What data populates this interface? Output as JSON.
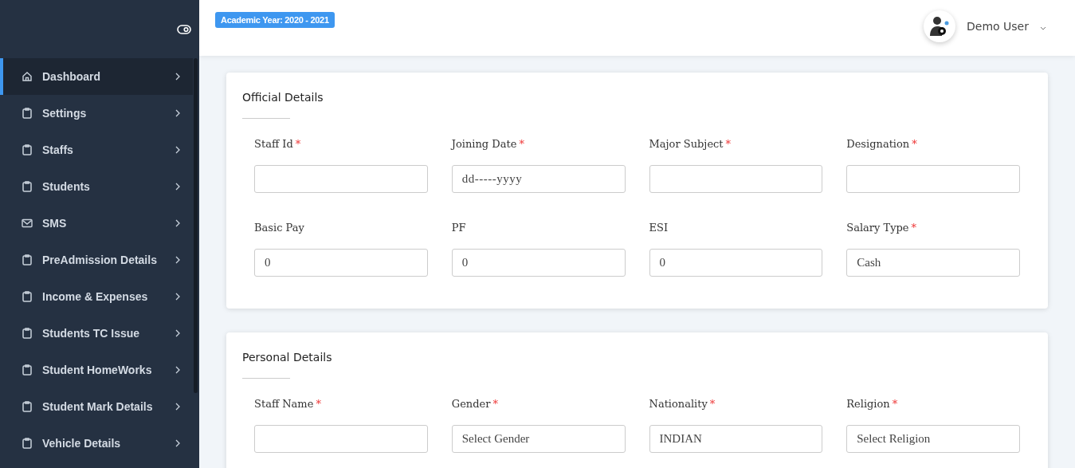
{
  "header": {
    "academic_year": "Academic Year: 2020 - 2021",
    "user_name": "Demo User"
  },
  "sidebar": {
    "items": [
      {
        "label": "Dashboard",
        "kind": "home",
        "selected": true
      },
      {
        "label": "Settings",
        "kind": "page",
        "selected": false
      },
      {
        "label": "Staffs",
        "kind": "page",
        "selected": false
      },
      {
        "label": "Students",
        "kind": "page",
        "selected": false
      },
      {
        "label": "SMS",
        "kind": "mail",
        "selected": false
      },
      {
        "label": "PreAdmission Details",
        "kind": "page",
        "selected": false
      },
      {
        "label": "Income & Expenses",
        "kind": "page",
        "selected": false
      },
      {
        "label": "Students TC Issue",
        "kind": "page",
        "selected": false
      },
      {
        "label": "Student HomeWorks",
        "kind": "page",
        "selected": false
      },
      {
        "label": "Student Mark Details",
        "kind": "page",
        "selected": false
      },
      {
        "label": "Vehicle Details",
        "kind": "page",
        "selected": false
      }
    ]
  },
  "sections": [
    {
      "title": "Official Details",
      "fields": [
        {
          "label": "Staff Id",
          "required_mark": "*"
        },
        {
          "label": "Joining Date",
          "required_mark": "*",
          "placeholder": "dd-----yyyy"
        },
        {
          "label": "Major Subject",
          "required_mark": "*"
        },
        {
          "label": "Designation",
          "required_mark": "*"
        },
        {
          "label": "Basic Pay",
          "value": "0"
        },
        {
          "label": "PF",
          "value": "0"
        },
        {
          "label": "ESI",
          "value": "0"
        },
        {
          "label": "Salary Type",
          "required_mark": "*",
          "value": "Cash"
        }
      ]
    },
    {
      "title": "Personal Details",
      "fields": [
        {
          "label": "Staff Name",
          "required_mark": "*"
        },
        {
          "label": "Gender",
          "required_mark": "*",
          "value": "Select Gender"
        },
        {
          "label": "Nationality",
          "required_mark": "*",
          "value": "INDIAN"
        },
        {
          "label": "Religion",
          "required_mark": "*",
          "value": "Select Religion"
        }
      ]
    }
  ]
}
